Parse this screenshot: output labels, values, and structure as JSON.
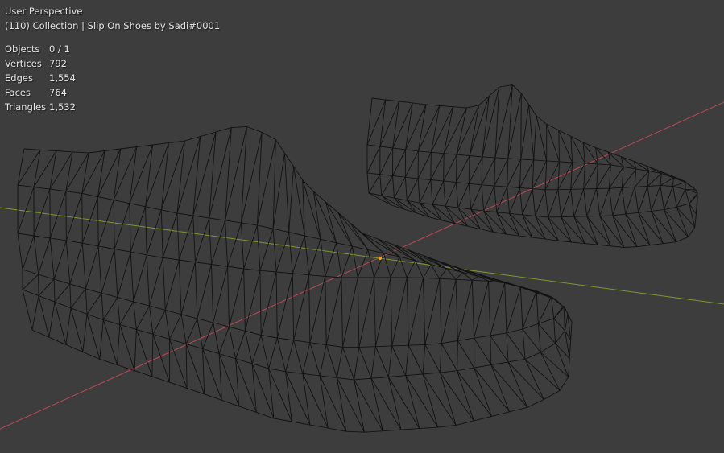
{
  "viewport": {
    "view_name": "User Perspective",
    "collection_info": "(110) Collection | Slip On Shoes by Sadi#0001",
    "stats": [
      {
        "label": "Objects",
        "value": "0 / 1"
      },
      {
        "label": "Vertices",
        "value": "792"
      },
      {
        "label": "Edges",
        "value": "1,554"
      },
      {
        "label": "Faces",
        "value": "764"
      },
      {
        "label": "Triangles",
        "value": "1,532"
      }
    ]
  },
  "colors": {
    "background": "#3d3d3d",
    "x_axis": "#b84a55",
    "y_axis": "#7a9a2e",
    "wireframe": "#121212",
    "origin": "#f0a020"
  }
}
